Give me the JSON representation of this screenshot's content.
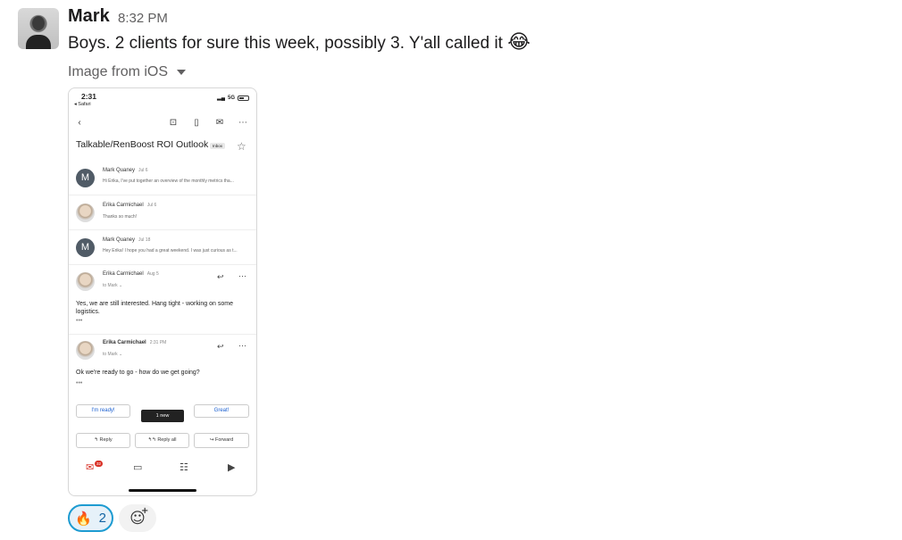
{
  "message": {
    "author": "Mark",
    "time": "8:32 PM",
    "text": "Boys. 2 clients for sure this week, possibly 3. Y'all called it",
    "emoji": "😂",
    "attachment_label": "Image from iOS"
  },
  "screenshot": {
    "status_time": "2:31",
    "status_app": "◂ Safari",
    "status_network": "5G",
    "subject": "Talkable/RenBoost ROI Outlook",
    "inbox_chip": "Inbox",
    "emails": [
      {
        "avatar": "M",
        "sender": "Mark Quaney",
        "date": "Jul 6",
        "snippet": "Hi Erika, I've put together an overview of the monthly metrics tha..."
      },
      {
        "avatar": "",
        "sender": "Erika Carmichael",
        "date": "Jul 6",
        "snippet": "Thanks so much!"
      },
      {
        "avatar": "M",
        "sender": "Mark Quaney",
        "date": "Jul 18",
        "snippet": "Hey Erika! I hope you had a great weekend. I was just curious as t..."
      },
      {
        "avatar": "",
        "sender": "Erika Carmichael",
        "date": "Aug 5",
        "to": "to Mark ⌄",
        "body": "Yes, we are still interested. Hang tight - working on some logistics."
      },
      {
        "avatar": "",
        "sender": "Erika Carmichael",
        "date": "2:31 PM",
        "to": "to Mark ⌄",
        "body": "Ok we're ready to go - how do we get going?"
      }
    ],
    "smart_replies": [
      "I'm ready!",
      "Great!"
    ],
    "new_pill": "1 new",
    "reply_buttons": [
      "Reply",
      "Reply all",
      "Forward"
    ],
    "mail_badge": "32"
  },
  "reaction": {
    "emoji": "🔥",
    "count": "2"
  },
  "icons": [
    "back-icon",
    "archive-icon",
    "trash-icon",
    "mail-icon",
    "more-icon",
    "star-icon",
    "reply-icon",
    "chat-icon",
    "spaces-icon",
    "video-icon",
    "add-reaction-icon"
  ]
}
